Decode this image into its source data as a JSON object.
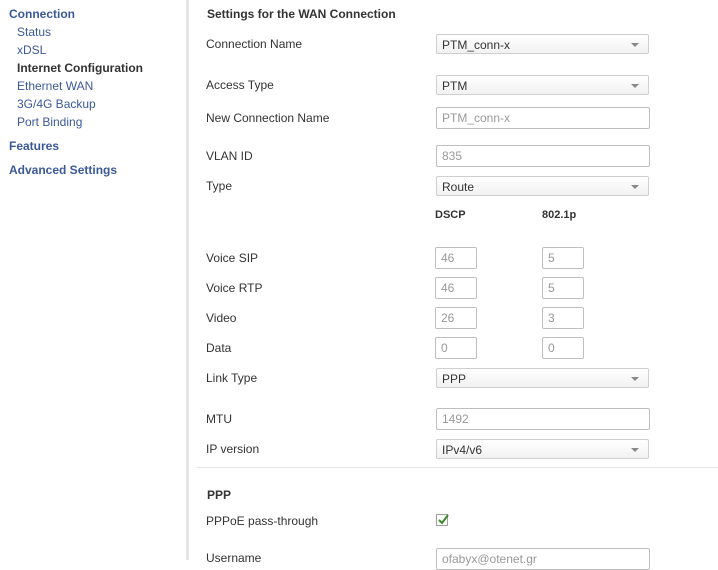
{
  "sidebar": {
    "sections": [
      {
        "label": "Connection"
      },
      {
        "label": "Features"
      },
      {
        "label": "Advanced Settings"
      }
    ],
    "connection_items": [
      {
        "label": "Status",
        "active": false
      },
      {
        "label": "xDSL",
        "active": false
      },
      {
        "label": "Internet Configuration",
        "active": true
      },
      {
        "label": "Ethernet WAN",
        "active": false
      },
      {
        "label": "3G/4G Backup",
        "active": false
      },
      {
        "label": "Port Binding",
        "active": false
      }
    ]
  },
  "form": {
    "section_title": "Settings for the WAN Connection",
    "connection_name": {
      "label": "Connection Name",
      "value": "PTM_conn-x"
    },
    "access_type": {
      "label": "Access Type",
      "value": "PTM"
    },
    "new_connection_name": {
      "label": "New Connection Name",
      "placeholder": "PTM_conn-x"
    },
    "vlan_id": {
      "label": "VLAN ID",
      "placeholder": "835"
    },
    "type": {
      "label": "Type",
      "value": "Route"
    },
    "qos_columns": {
      "dscp": "DSCP",
      "p8021": "802.1p"
    },
    "qos_rows": [
      {
        "label": "Voice SIP",
        "dscp": "46",
        "p8021": "5"
      },
      {
        "label": "Voice RTP",
        "dscp": "46",
        "p8021": "5"
      },
      {
        "label": "Video",
        "dscp": "26",
        "p8021": "3"
      },
      {
        "label": "Data",
        "dscp": "0",
        "p8021": "0"
      }
    ],
    "link_type": {
      "label": "Link Type",
      "value": "PPP"
    },
    "mtu": {
      "label": "MTU",
      "placeholder": "1492"
    },
    "ip_version": {
      "label": "IP version",
      "value": "IPv4/v6"
    }
  },
  "ppp": {
    "section_title": "PPP",
    "pppoe_passthrough": {
      "label": "PPPoE pass-through",
      "checked": true
    },
    "username": {
      "label": "Username",
      "placeholder": "ofabyx@otenet.gr"
    }
  },
  "colors": {
    "link": "#3b5998",
    "text": "#333333",
    "check": "#3a8a2a"
  }
}
